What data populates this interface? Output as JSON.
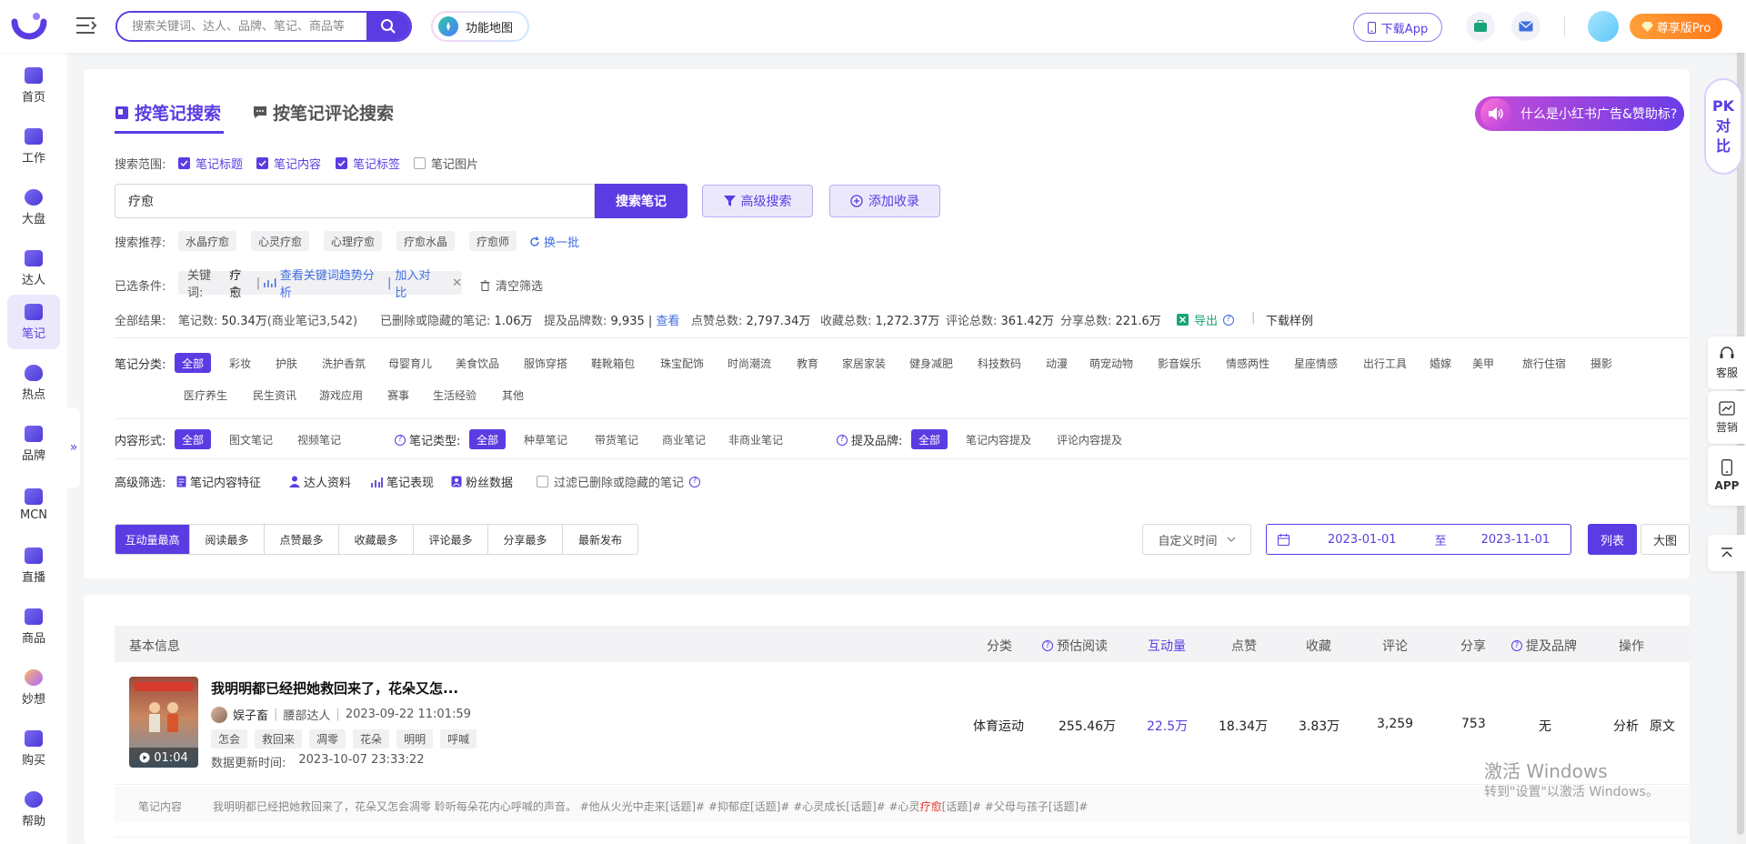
{
  "topbar": {
    "search_placeholder": "搜索关键词、达人、品牌、笔记、商品等",
    "func_map": "功能地图",
    "download_app": "下载App",
    "pro": "尊享版Pro"
  },
  "sidebar": {
    "items": [
      {
        "label": "首页"
      },
      {
        "label": "工作"
      },
      {
        "label": "大盘"
      },
      {
        "label": "达人"
      },
      {
        "label": "笔记"
      },
      {
        "label": "热点"
      },
      {
        "label": "品牌"
      },
      {
        "label": "MCN"
      },
      {
        "label": "直播"
      },
      {
        "label": "商品"
      },
      {
        "label": "妙想"
      },
      {
        "label": "购买"
      },
      {
        "label": "帮助"
      }
    ],
    "collapse": "»"
  },
  "tabs": {
    "by_note": "按笔记搜索",
    "by_comment": "按笔记评论搜索"
  },
  "ad": "什么是小红书广告&赞助标?",
  "pk": [
    "PK",
    "对",
    "比"
  ],
  "scope": {
    "label": "搜索范围:",
    "options": [
      {
        "label": "笔记标题",
        "checked": true
      },
      {
        "label": "笔记内容",
        "checked": true
      },
      {
        "label": "笔记标签",
        "checked": true
      },
      {
        "label": "笔记图片",
        "checked": false
      }
    ]
  },
  "keyword": {
    "value": "疗愈",
    "search": "搜索笔记",
    "advanced": "高级搜索",
    "add": "添加收录"
  },
  "recommend": {
    "label": "搜索推荐:",
    "tags": [
      "水晶疗愈",
      "心灵疗愈",
      "心理疗愈",
      "疗愈水晶",
      "疗愈师"
    ],
    "refresh": "换一批"
  },
  "conditions": {
    "label": "已选条件:",
    "kw_label": "关键词:",
    "kw_value": "疗愈",
    "trend": "查看关键词趋势分析",
    "compare": "加入对比",
    "clear": "清空筛选"
  },
  "results": {
    "label": "全部结果:",
    "notes_k": "笔记数:",
    "notes_v": "50.34万",
    "notes_sub": "(商业笔记3,542)",
    "deleted_k": "已删除或隐藏的笔记:",
    "deleted_v": "1.06万",
    "brands_k": "提及品牌数:",
    "brands_v": "9,935",
    "view": "查看",
    "likes_k": "点赞总数:",
    "likes_v": "2,797.34万",
    "collect_k": "收藏总数:",
    "collect_v": "1,272.37万",
    "comment_k": "评论总数:",
    "comment_v": "361.42万",
    "share_k": "分享总数:",
    "share_v": "221.6万",
    "export": "导出",
    "sample": "下载样例"
  },
  "category": {
    "label": "笔记分类:",
    "row1": [
      "全部",
      "彩妆",
      "护肤",
      "洗护香氛",
      "母婴育儿",
      "美食饮品",
      "服饰穿搭",
      "鞋靴箱包",
      "珠宝配饰",
      "时尚潮流",
      "教育",
      "家居家装",
      "健身减肥",
      "科技数码",
      "动漫",
      "萌宠动物",
      "影音娱乐",
      "情感两性",
      "星座情感",
      "出行工具",
      "婚嫁",
      "美甲",
      "旅行住宿",
      "摄影"
    ],
    "row2": [
      "医疗养生",
      "民生资讯",
      "游戏应用",
      "赛事",
      "生活经验",
      "其他"
    ]
  },
  "form": {
    "label": "内容形式:",
    "options": [
      "全部",
      "图文笔记",
      "视频笔记"
    ],
    "type_label": "笔记类型:",
    "type_options": [
      "全部",
      "种草笔记",
      "带货笔记",
      "商业笔记",
      "非商业笔记"
    ],
    "brand_label": "提及品牌:",
    "brand_options": [
      "全部",
      "笔记内容提及",
      "评论内容提及"
    ]
  },
  "advanced": {
    "label": "高级筛选:",
    "options": [
      "笔记内容特征",
      "达人资料",
      "笔记表现",
      "粉丝数据"
    ],
    "filter_deleted": "过滤已删除或隐藏的笔记"
  },
  "sort": {
    "options": [
      "互动量最高",
      "阅读最多",
      "点赞最多",
      "收藏最多",
      "评论最多",
      "分享最多",
      "最新发布"
    ],
    "time_select": "自定义时间",
    "date_from": "2023-01-01",
    "date_to": "2023-11-01",
    "date_sep": "至",
    "view_list": "列表",
    "view_big": "大图"
  },
  "table": {
    "headers": {
      "basic": "基本信息",
      "category": "分类",
      "est_read": "预估阅读",
      "interact": "互动量",
      "likes": "点赞",
      "collect": "收藏",
      "comment": "评论",
      "share": "分享",
      "brand": "提及品牌",
      "action": "操作"
    },
    "rows": [
      {
        "title": "我明明都已经把她救回来了，花朵又怎...",
        "author": "娱子畜",
        "level": "腰部达人",
        "date": "2023-09-22 11:01:59",
        "tags": [
          "怎会",
          "救回来",
          "凋零",
          "花朵",
          "明明",
          "呼喊"
        ],
        "update_label": "数据更新时间:",
        "update_time": "2023-10-07 23:33:22",
        "duration": "01:04",
        "thumb_caption": "体育运动",
        "category": "体育运动",
        "est_read": "255.46万",
        "interact": "22.5万",
        "likes": "18.34万",
        "collect": "3.83万",
        "comment": "3,259",
        "share": "753",
        "brand": "无",
        "analyze": "分析",
        "original": "原文",
        "content_label": "笔记内容",
        "content_before": "我明明都已经把她救回来了，花朵又怎会凋零 聆听每朵花内心呼喊的声音。 #他从火光中走来[话题]# #抑郁症[话题]# #心灵成长[话题]# #心灵",
        "content_highlight": "疗愈",
        "content_after": "[话题]# #父母与孩子[话题]#"
      }
    ]
  },
  "float": {
    "service": "客服",
    "marketing": "营销",
    "app": "APP"
  },
  "watermark": {
    "line1": "激活 Windows",
    "line2": "转到\"设置\"以激活 Windows。"
  },
  "colors": {
    "accent": "#5b3ce2",
    "link": "#3f6fe0",
    "orange": "#ff8a1f",
    "highlight": "#e5322d"
  }
}
